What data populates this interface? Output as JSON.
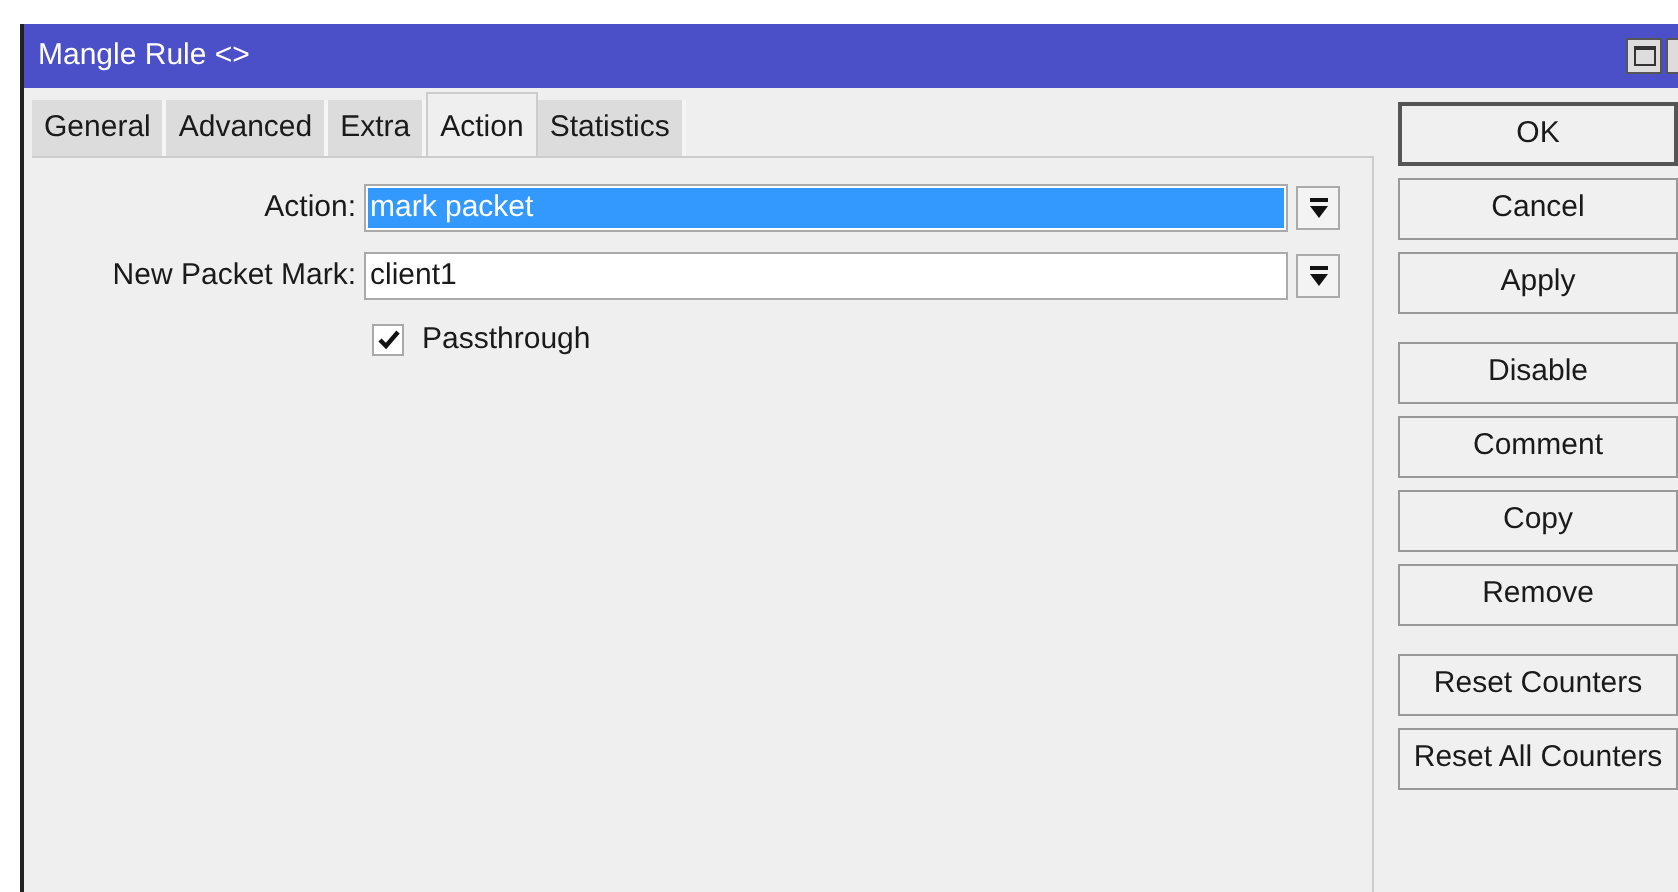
{
  "window": {
    "title": "Mangle Rule <>"
  },
  "tabs": [
    {
      "label": "General",
      "selected": false
    },
    {
      "label": "Advanced",
      "selected": false
    },
    {
      "label": "Extra",
      "selected": false
    },
    {
      "label": "Action",
      "selected": true
    },
    {
      "label": "Statistics",
      "selected": false
    }
  ],
  "fields": [
    {
      "label": "Action:",
      "value": "mark packet",
      "selected": true
    },
    {
      "label": "New Packet Mark:",
      "value": "client1",
      "selected": false
    }
  ],
  "passthrough": {
    "label": "Passthrough",
    "checked": true
  },
  "button_groups": [
    [
      {
        "label": "OK",
        "default": true
      },
      {
        "label": "Cancel",
        "default": false
      },
      {
        "label": "Apply",
        "default": false
      }
    ],
    [
      {
        "label": "Disable",
        "default": false
      },
      {
        "label": "Comment",
        "default": false
      },
      {
        "label": "Copy",
        "default": false
      },
      {
        "label": "Remove",
        "default": false
      }
    ],
    [
      {
        "label": "Reset Counters",
        "default": false
      },
      {
        "label": "Reset All Counters",
        "default": false
      }
    ]
  ]
}
